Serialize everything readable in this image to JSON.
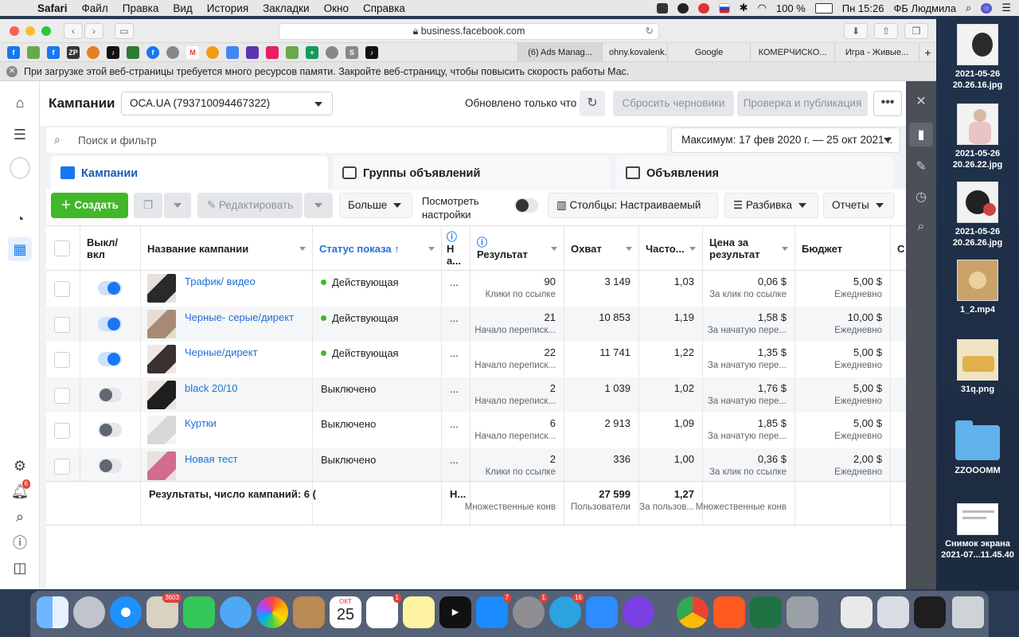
{
  "menubar": {
    "app": "Safari",
    "items": [
      "Файл",
      "Правка",
      "Вид",
      "История",
      "Закладки",
      "Окно",
      "Справка"
    ],
    "battery": "100 %",
    "clock": "Пн 15:26",
    "user": "ФБ Людмила"
  },
  "browser": {
    "url": "business.facebook.com",
    "tabs": [
      "(6) Ads Manag...",
      "ohny.kovalenk...",
      "Google",
      "КОМЕРЧИСКО...",
      "Игра - Живые..."
    ],
    "notice": "При загрузке этой веб-страницы требуется много ресурсов памяти. Закройте веб-страницу, чтобы повысить скорость работы Mac."
  },
  "header": {
    "title": "Кампании",
    "account": "ОСА.UA (793710094467322)",
    "updated": "Обновлено только что",
    "reset_drafts": "Сбросить черновики",
    "review_publish": "Проверка и публикация",
    "more": "•••"
  },
  "search": {
    "placeholder": "Поиск и фильтр"
  },
  "date_range": "Максимум: 17 фев 2020 г. — 25 окт 2021 г.",
  "levels": {
    "campaigns": "Кампании",
    "adsets": "Группы объявлений",
    "ads": "Объявления"
  },
  "actions": {
    "create": "Создать",
    "edit": "Редактировать",
    "more": "Больше",
    "view_settings_1": "Посмотреть",
    "view_settings_2": "настройки",
    "columns": "Столбцы: Настраиваемый",
    "breakdown": "Разбивка",
    "reports": "Отчеты"
  },
  "table": {
    "headers": {
      "toggle_1": "Выкл/",
      "toggle_2": "вкл",
      "name": "Название кампании",
      "status": "Статус показа ↑",
      "n_1": "Н",
      "n_2": "а...",
      "result": "Результат",
      "reach": "Охват",
      "frequency": "Часто...",
      "cpr_1": "Цена за",
      "cpr_2": "результат",
      "budget": "Бюджет",
      "extra": "С"
    },
    "rows": [
      {
        "on": true,
        "name": "Трафик/ видео",
        "status": "Действующая",
        "active": true,
        "n": "...",
        "result": "90",
        "result_sub": "Клики по ссылке",
        "reach": "3 149",
        "freq": "1,03",
        "cpr": "0,06 $",
        "cpr_sub": "За клик по ссылке",
        "budget": "5,00 $",
        "budget_sub": "Ежедневно"
      },
      {
        "on": true,
        "name": "Черные- серые/директ",
        "status": "Действующая",
        "active": true,
        "n": "...",
        "result": "21",
        "result_sub": "Начало переписк...",
        "reach": "10 853",
        "freq": "1,19",
        "cpr": "1,58 $",
        "cpr_sub": "За начатую пере...",
        "budget": "10,00 $",
        "budget_sub": "Ежедневно"
      },
      {
        "on": true,
        "name": "Черные/директ",
        "status": "Действующая",
        "active": true,
        "n": "...",
        "result": "22",
        "result_sub": "Начало переписк...",
        "reach": "11 741",
        "freq": "1,22",
        "cpr": "1,35 $",
        "cpr_sub": "За начатую пере...",
        "budget": "5,00 $",
        "budget_sub": "Ежедневно"
      },
      {
        "on": false,
        "name": "black 20/10",
        "status": "Выключено",
        "active": false,
        "n": "...",
        "result": "2",
        "result_sub": "Начало переписк...",
        "reach": "1 039",
        "freq": "1,02",
        "cpr": "1,76 $",
        "cpr_sub": "За начатую пере...",
        "budget": "5,00 $",
        "budget_sub": "Ежедневно"
      },
      {
        "on": false,
        "name": "Куртки",
        "status": "Выключено",
        "active": false,
        "n": "...",
        "result": "6",
        "result_sub": "Начало переписк...",
        "reach": "2 913",
        "freq": "1,09",
        "cpr": "1,85 $",
        "cpr_sub": "За начатую пере...",
        "budget": "5,00 $",
        "budget_sub": "Ежедневно"
      },
      {
        "on": false,
        "name": "Новая тест",
        "status": "Выключено",
        "active": false,
        "n": "...",
        "result": "2",
        "result_sub": "Клики по ссылке",
        "reach": "336",
        "freq": "1,00",
        "cpr": "0,36 $",
        "cpr_sub": "За клик по ссылке",
        "budget": "2,00 $",
        "budget_sub": "Ежедневно"
      }
    ],
    "footer": {
      "label": "Результаты, число кампаний: 6 (",
      "n": "Н...",
      "result_sub": "Множественные конв",
      "reach": "27 599",
      "reach_sub": "Пользователи",
      "freq": "1,27",
      "freq_sub": "За пользов...",
      "cpr_sub": "Множественные конв"
    }
  },
  "desktop": [
    {
      "label_1": "2021-05-26",
      "label_2": "20.26.16.jpg"
    },
    {
      "label_1": "2021-05-26",
      "label_2": "20.26.22.jpg"
    },
    {
      "label_1": "2021-05-26",
      "label_2": "20.26.26.jpg"
    },
    {
      "label_1": "1_2.mp4",
      "label_2": ""
    },
    {
      "label_1": "31q.png",
      "label_2": ""
    },
    {
      "label_1": "ZZOOOMM",
      "label_2": ""
    },
    {
      "label_1": "Снимок экрана",
      "label_2": "2021-07...11.45.40"
    }
  ],
  "dock": {
    "mail_badge": "3603",
    "calendar_month": "ОКТ",
    "calendar_day": "25",
    "reminders_badge": "1",
    "appstore_badge": "7",
    "prefs_badge": "1",
    "telegram_badge": "16"
  },
  "nav": {
    "notifications_badge": "6"
  },
  "colors": {
    "accent": "#1877f2",
    "link": "#216fdb",
    "create": "#42b72a",
    "toggle_on": "#1877f2"
  }
}
